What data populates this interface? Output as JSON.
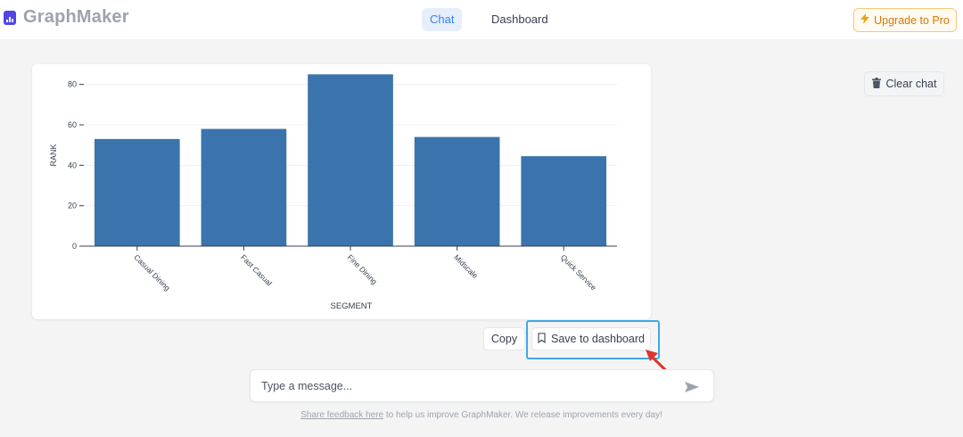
{
  "header": {
    "app_name": "GraphMaker",
    "nav": {
      "chat_label": "Chat",
      "dashboard_label": "Dashboard"
    },
    "upgrade_label": "Upgrade to Pro",
    "upgrade_icon": "lightning-icon",
    "accent_color": "#3b82f6",
    "upgrade_color": "#d97706"
  },
  "chat_panel": {
    "clear_label": "Clear chat",
    "clear_icon": "trash-icon"
  },
  "chart_data": {
    "type": "bar",
    "categories": [
      "Casual Dining",
      "Fast Casual",
      "Fine Dining",
      "Midscale",
      "Quick Service"
    ],
    "values": [
      53,
      58,
      85,
      54,
      44.5
    ],
    "xlabel": "SEGMENT",
    "ylabel": "RANK",
    "ylim": [
      0,
      90
    ],
    "yticks": [
      0,
      20,
      40,
      60,
      80
    ],
    "bar_color": "#3b74ad",
    "grid": true
  },
  "actions": {
    "copy_label": "Copy",
    "save_label": "Save to dashboard",
    "save_icon": "bookmark-icon",
    "highlight_color": "#3fa7e8",
    "arrow_color": "#e0352b"
  },
  "composer": {
    "placeholder": "Type a message...",
    "send_icon": "send-icon"
  },
  "footer": {
    "link_text": "Share feedback here",
    "text": " to help us improve GraphMaker. We release improvements every day!"
  }
}
